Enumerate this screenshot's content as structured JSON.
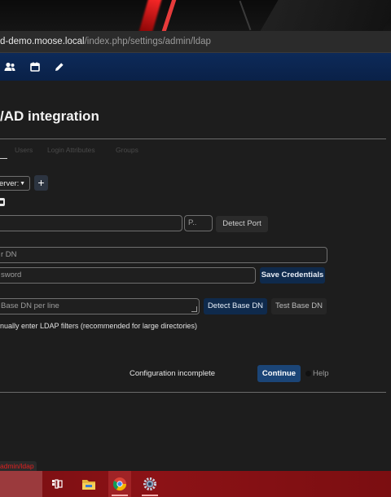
{
  "browser": {
    "url_host": "d-demo.moose.local",
    "url_path": "/index.php/settings/admin/ldap"
  },
  "header": {
    "icons": [
      "contacts-icon",
      "calendar-icon",
      "pencil-icon"
    ]
  },
  "page": {
    "title": "/AD integration",
    "tabs": [
      "Users",
      "Login Attributes",
      "Groups"
    ]
  },
  "server": {
    "select_value": "erver:",
    "add_label": "+"
  },
  "host_section": {
    "host_value": "",
    "port_placeholder": "P..",
    "detect_port_label": "Detect Port"
  },
  "credentials": {
    "user_dn_placeholder": "r DN",
    "password_placeholder": "sword",
    "save_label": "Save Credentials"
  },
  "base_dn": {
    "placeholder": "Base DN per line",
    "detect_label": "Detect Base DN",
    "test_label": "Test Base DN"
  },
  "manual_filters_label": "nually enter LDAP filters (recommended for large directories)",
  "footer": {
    "status": "Configuration incomplete",
    "continue_label": "Continue",
    "help_label": "Help"
  },
  "status_url_tip": "admin/ldap",
  "taskbar": {
    "icons": [
      "task-view-icon",
      "file-explorer-icon",
      "chrome-icon",
      "settings-gear-icon"
    ]
  },
  "colors": {
    "header_bg": "#0d2a59",
    "primary_button": "#1b4577",
    "taskbar": "#8c1216"
  }
}
